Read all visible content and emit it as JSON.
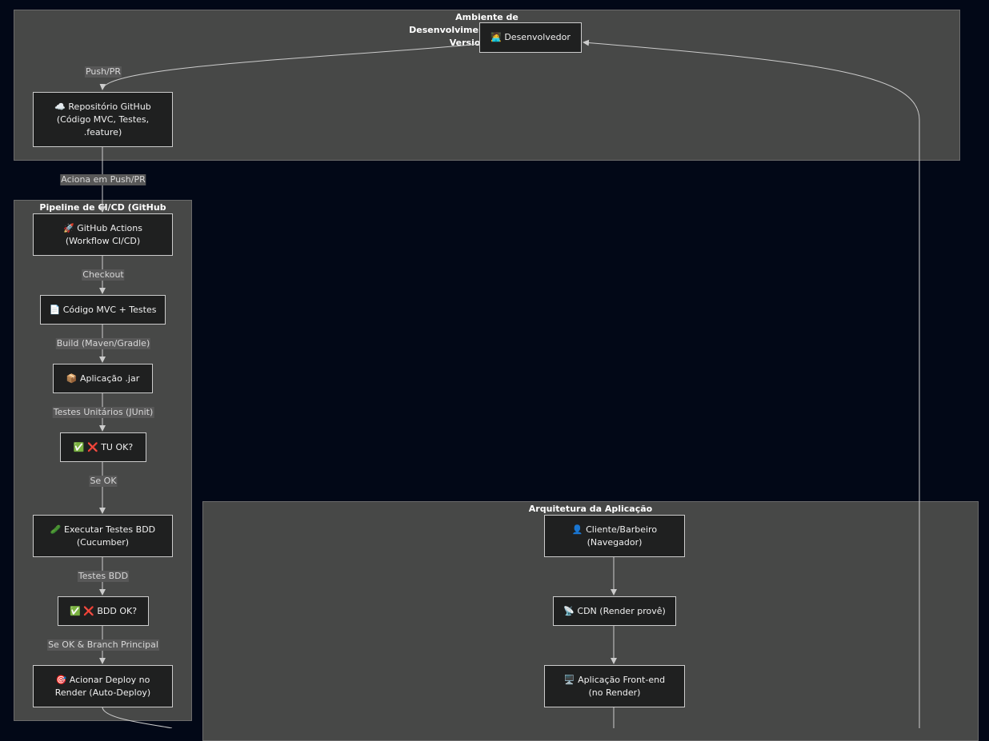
{
  "clusters": {
    "dev": {
      "title": "Ambiente de\nDesenvolvimento e Controle de\nVersionamento"
    },
    "pipeline": {
      "title": "Pipeline de CI/CD (GitHub"
    },
    "arch": {
      "title": "Arquitetura da Aplicação"
    }
  },
  "nodes": {
    "dev": "🧑‍💻 Desenvolvedor",
    "repo": "☁️ Repositório GitHub\n(Código MVC, Testes,\n.feature)",
    "actions": "🚀 GitHub Actions\n(Workflow CI/CD)",
    "code": "📄 Código MVC + Testes",
    "jar": "📦 Aplicação .jar",
    "tu": "✅ ❌ TU OK?",
    "bddrun": "🥒 Executar Testes BDD\n(Cucumber)",
    "bddok": "✅ ❌ BDD OK?",
    "deploy": "🎯 Acionar Deploy no\nRender (Auto-Deploy)",
    "client": "👤 Cliente/Barbeiro\n(Navegador)",
    "cdn": "📡 CDN (Render provê)",
    "frontend": "🖥️ Aplicação Front-end\n(no Render)"
  },
  "edges": {
    "push_pr": "Push/PR",
    "trigger": "Aciona em Push/PR",
    "checkout": "Checkout",
    "build": "Build (Maven/Gradle)",
    "unit": "Testes Unitários (JUnit)",
    "se_ok": "Se OK",
    "bdd_tests": "Testes BDD",
    "se_ok_branch": "Se OK & Branch Principal"
  },
  "colors": {
    "background": "#020817",
    "cluster": "#474847",
    "node": "#1f2020",
    "edge": "#cccccc"
  }
}
